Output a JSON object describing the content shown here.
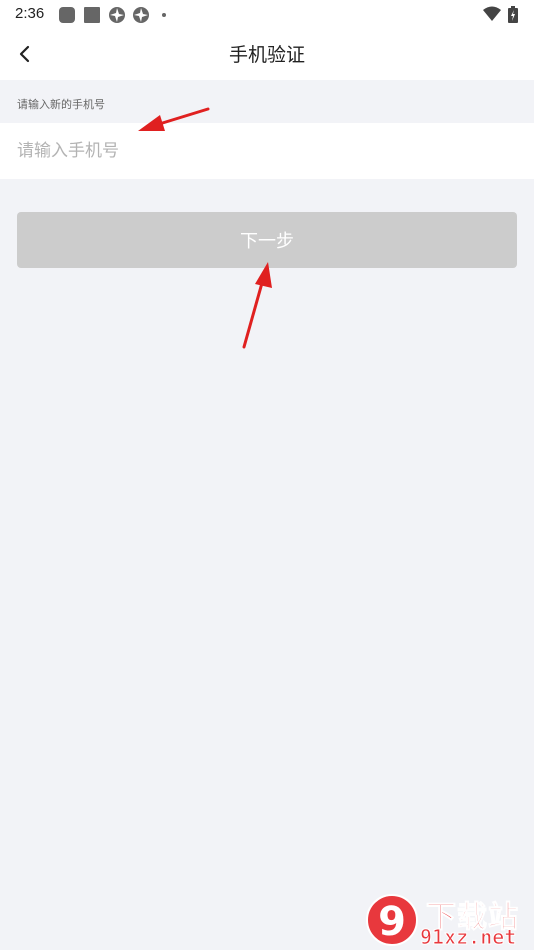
{
  "status_bar": {
    "time": "2:36"
  },
  "header": {
    "title": "手机验证",
    "back_icon": "chevron-left-icon"
  },
  "form": {
    "hint": "请输入新的手机号",
    "phone_placeholder": "请输入手机号",
    "phone_value": ""
  },
  "next_button": {
    "label": "下一步"
  },
  "watermark": {
    "logo_text": "9",
    "cn": "下载站",
    "en": "91xz.net"
  },
  "colors": {
    "background": "#f2f3f7",
    "button_disabled": "#cccccc",
    "annotation_arrow": "#e02020",
    "watermark": "#e8383d"
  }
}
